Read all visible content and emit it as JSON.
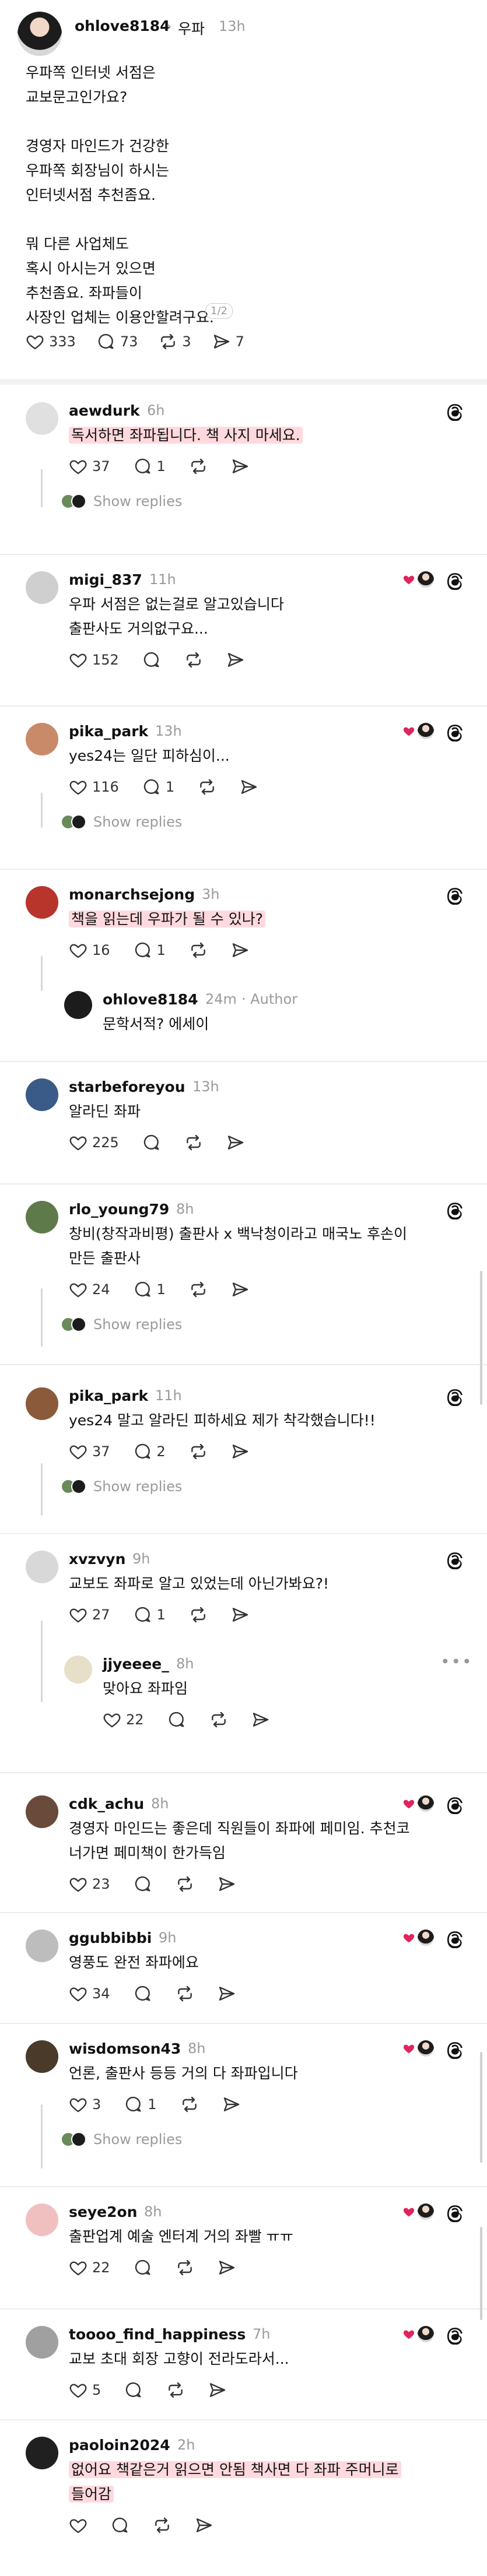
{
  "post": {
    "author": "ohlove8184",
    "tag": "우파",
    "time": "13h",
    "text": "우파쪽 인터넷 서점은\n교보문고인가요?\n\n경영자 마인드가 건강한\n우파쪽 회장님이 하시는\n인터넷서점 추천좀요.\n\n뭐 다른 사업체도\n혹시 아시는거 있으면\n추천좀요. 좌파들이\n사장인 업체는 이용안할려구요.",
    "pager": "1/2",
    "likes": "333",
    "comments": "73",
    "reposts": "3",
    "shares": "7"
  },
  "comments": [
    {
      "author": "aewdurk",
      "time": "6h",
      "text": "독서하면 좌파됩니다. 책 사지 마세요.",
      "likes": "37",
      "comments": "1",
      "show_replies": "Show replies"
    },
    {
      "author": "migi_837",
      "time": "11h",
      "text": "우파 서점은 없는걸로 알고있습니다\n출판사도 거의없구요...",
      "likes": "152",
      "comments": ""
    },
    {
      "author": "pika_park",
      "time": "13h",
      "text": "yes24는 일단 피하심이...",
      "likes": "116",
      "comments": "1",
      "show_replies": "Show replies"
    },
    {
      "author": "monarchsejong",
      "time": "3h",
      "text": "책을 읽는데 우파가 될 수 있나?",
      "likes": "16",
      "comments": "1"
    },
    {
      "author": "ohlove8184",
      "time": "24m",
      "author_tag": "· Author",
      "text": "문학서적? 에세이"
    },
    {
      "author": "starbeforeyou",
      "time": "13h",
      "text": "알라딘 좌파",
      "likes": "225",
      "comments": ""
    },
    {
      "author": "rlo_young79",
      "time": "8h",
      "text": "창비(창작과비평) 출판사 x 백낙청이라고 매국노 후손이\n만든 출판사",
      "likes": "24",
      "comments": "1",
      "show_replies": "Show replies"
    },
    {
      "author": "pika_park",
      "time": "11h",
      "text": "yes24 말고 알라딘 피하세요 제가 착각했습니다!!",
      "likes": "37",
      "comments": "2",
      "show_replies": "Show replies"
    },
    {
      "author": "xvzvyn",
      "time": "9h",
      "text": "교보도 좌파로 알고 있었는데 아닌가봐요?!",
      "likes": "27",
      "comments": "1"
    },
    {
      "author": "jjyeeee_",
      "time": "8h",
      "text": "맞아요 좌파임",
      "likes": "22",
      "comments": ""
    },
    {
      "author": "cdk_achu",
      "time": "8h",
      "text": "경영자 마인드는 좋은데 직원들이 좌파에 페미임. 추천코\n너가면 페미책이 한가득임",
      "likes": "23",
      "comments": ""
    },
    {
      "author": "ggubbibbi",
      "time": "9h",
      "text": "영풍도 완전 좌파에요",
      "likes": "34",
      "comments": ""
    },
    {
      "author": "wisdomson43",
      "time": "8h",
      "text": "언론, 출판사 등등 거의 다 좌파입니다",
      "likes": "3",
      "comments": "1",
      "show_replies": "Show replies"
    },
    {
      "author": "seye2on",
      "time": "8h",
      "text": "출판업계 예술 엔터계 거의 좌빨 ㅠㅠ",
      "likes": "22",
      "comments": ""
    },
    {
      "author": "toooo_find_happiness",
      "time": "7h",
      "text": "교보 초대 회장 고향이 전라도라서...",
      "likes": "5",
      "comments": ""
    },
    {
      "author": "paoloin2024",
      "time": "2h",
      "text": "없어요 책같은거 읽으면 안됨 책사면 다 좌파 주머니로\n들어감",
      "likes": "",
      "comments": ""
    }
  ],
  "icons": {
    "like": "heart-icon",
    "comment": "comment-icon",
    "repost": "repost-icon",
    "share": "share-icon",
    "threads": "threads-logo-icon",
    "liked_by": "heart-avatar-icon"
  },
  "colors": {
    "highlight": "#ffd9de",
    "muted": "#9a9a9a",
    "liked": "#e0245e"
  }
}
